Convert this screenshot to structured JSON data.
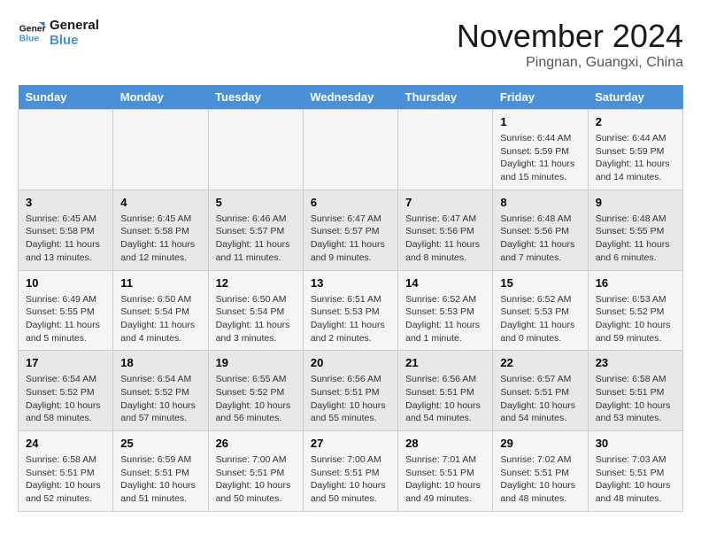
{
  "logo": {
    "line1": "General",
    "line2": "Blue"
  },
  "title": "November 2024",
  "subtitle": "Pingnan, Guangxi, China",
  "weekdays": [
    "Sunday",
    "Monday",
    "Tuesday",
    "Wednesday",
    "Thursday",
    "Friday",
    "Saturday"
  ],
  "weeks": [
    [
      {
        "day": "",
        "text": ""
      },
      {
        "day": "",
        "text": ""
      },
      {
        "day": "",
        "text": ""
      },
      {
        "day": "",
        "text": ""
      },
      {
        "day": "",
        "text": ""
      },
      {
        "day": "1",
        "text": "Sunrise: 6:44 AM\nSunset: 5:59 PM\nDaylight: 11 hours and 15 minutes."
      },
      {
        "day": "2",
        "text": "Sunrise: 6:44 AM\nSunset: 5:59 PM\nDaylight: 11 hours and 14 minutes."
      }
    ],
    [
      {
        "day": "3",
        "text": "Sunrise: 6:45 AM\nSunset: 5:58 PM\nDaylight: 11 hours and 13 minutes."
      },
      {
        "day": "4",
        "text": "Sunrise: 6:45 AM\nSunset: 5:58 PM\nDaylight: 11 hours and 12 minutes."
      },
      {
        "day": "5",
        "text": "Sunrise: 6:46 AM\nSunset: 5:57 PM\nDaylight: 11 hours and 11 minutes."
      },
      {
        "day": "6",
        "text": "Sunrise: 6:47 AM\nSunset: 5:57 PM\nDaylight: 11 hours and 9 minutes."
      },
      {
        "day": "7",
        "text": "Sunrise: 6:47 AM\nSunset: 5:56 PM\nDaylight: 11 hours and 8 minutes."
      },
      {
        "day": "8",
        "text": "Sunrise: 6:48 AM\nSunset: 5:56 PM\nDaylight: 11 hours and 7 minutes."
      },
      {
        "day": "9",
        "text": "Sunrise: 6:48 AM\nSunset: 5:55 PM\nDaylight: 11 hours and 6 minutes."
      }
    ],
    [
      {
        "day": "10",
        "text": "Sunrise: 6:49 AM\nSunset: 5:55 PM\nDaylight: 11 hours and 5 minutes."
      },
      {
        "day": "11",
        "text": "Sunrise: 6:50 AM\nSunset: 5:54 PM\nDaylight: 11 hours and 4 minutes."
      },
      {
        "day": "12",
        "text": "Sunrise: 6:50 AM\nSunset: 5:54 PM\nDaylight: 11 hours and 3 minutes."
      },
      {
        "day": "13",
        "text": "Sunrise: 6:51 AM\nSunset: 5:53 PM\nDaylight: 11 hours and 2 minutes."
      },
      {
        "day": "14",
        "text": "Sunrise: 6:52 AM\nSunset: 5:53 PM\nDaylight: 11 hours and 1 minute."
      },
      {
        "day": "15",
        "text": "Sunrise: 6:52 AM\nSunset: 5:53 PM\nDaylight: 11 hours and 0 minutes."
      },
      {
        "day": "16",
        "text": "Sunrise: 6:53 AM\nSunset: 5:52 PM\nDaylight: 10 hours and 59 minutes."
      }
    ],
    [
      {
        "day": "17",
        "text": "Sunrise: 6:54 AM\nSunset: 5:52 PM\nDaylight: 10 hours and 58 minutes."
      },
      {
        "day": "18",
        "text": "Sunrise: 6:54 AM\nSunset: 5:52 PM\nDaylight: 10 hours and 57 minutes."
      },
      {
        "day": "19",
        "text": "Sunrise: 6:55 AM\nSunset: 5:52 PM\nDaylight: 10 hours and 56 minutes."
      },
      {
        "day": "20",
        "text": "Sunrise: 6:56 AM\nSunset: 5:51 PM\nDaylight: 10 hours and 55 minutes."
      },
      {
        "day": "21",
        "text": "Sunrise: 6:56 AM\nSunset: 5:51 PM\nDaylight: 10 hours and 54 minutes."
      },
      {
        "day": "22",
        "text": "Sunrise: 6:57 AM\nSunset: 5:51 PM\nDaylight: 10 hours and 54 minutes."
      },
      {
        "day": "23",
        "text": "Sunrise: 6:58 AM\nSunset: 5:51 PM\nDaylight: 10 hours and 53 minutes."
      }
    ],
    [
      {
        "day": "24",
        "text": "Sunrise: 6:58 AM\nSunset: 5:51 PM\nDaylight: 10 hours and 52 minutes."
      },
      {
        "day": "25",
        "text": "Sunrise: 6:59 AM\nSunset: 5:51 PM\nDaylight: 10 hours and 51 minutes."
      },
      {
        "day": "26",
        "text": "Sunrise: 7:00 AM\nSunset: 5:51 PM\nDaylight: 10 hours and 50 minutes."
      },
      {
        "day": "27",
        "text": "Sunrise: 7:00 AM\nSunset: 5:51 PM\nDaylight: 10 hours and 50 minutes."
      },
      {
        "day": "28",
        "text": "Sunrise: 7:01 AM\nSunset: 5:51 PM\nDaylight: 10 hours and 49 minutes."
      },
      {
        "day": "29",
        "text": "Sunrise: 7:02 AM\nSunset: 5:51 PM\nDaylight: 10 hours and 48 minutes."
      },
      {
        "day": "30",
        "text": "Sunrise: 7:03 AM\nSunset: 5:51 PM\nDaylight: 10 hours and 48 minutes."
      }
    ]
  ]
}
